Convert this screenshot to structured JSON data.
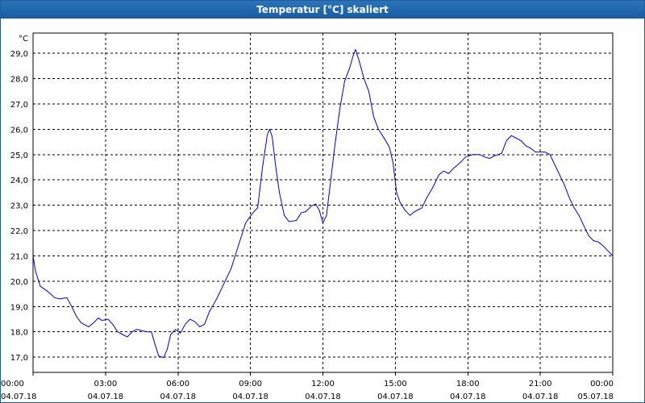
{
  "window": {
    "title": "Temperatur [°C] skaliert"
  },
  "chart_data": {
    "type": "line",
    "title": "Temperatur [°C] skaliert",
    "xlabel": "",
    "ylabel": "°C",
    "grid": true,
    "line_color": "#0000cc",
    "grid_color": "#000000",
    "ylim": [
      16.4,
      29.8
    ],
    "x_range_hours": [
      0,
      24
    ],
    "y_ticks": [
      "29,0",
      "28,0",
      "27,0",
      "26,0",
      "25,0",
      "24,0",
      "23,0",
      "22,0",
      "21,0",
      "20,0",
      "19,0",
      "18,0",
      "17,0"
    ],
    "y_tick_values": [
      29,
      28,
      27,
      26,
      25,
      24,
      23,
      22,
      21,
      20,
      19,
      18,
      17
    ],
    "x_ticks": [
      {
        "time": "00:00",
        "date": "04.07.18",
        "hour": 0
      },
      {
        "time": "03:00",
        "date": "04.07.18",
        "hour": 3
      },
      {
        "time": "06:00",
        "date": "04.07.18",
        "hour": 6
      },
      {
        "time": "09:00",
        "date": "04.07.18",
        "hour": 9
      },
      {
        "time": "12:00",
        "date": "04.07.18",
        "hour": 12
      },
      {
        "time": "15:00",
        "date": "04.07.18",
        "hour": 15
      },
      {
        "time": "18:00",
        "date": "04.07.18",
        "hour": 18
      },
      {
        "time": "21:00",
        "date": "04.07.18",
        "hour": 21
      },
      {
        "time": "00:00",
        "date": "05.07.18",
        "hour": 24
      }
    ],
    "series": [
      {
        "name": "",
        "points": [
          [
            0.0,
            21.0
          ],
          [
            0.1,
            20.4
          ],
          [
            0.3,
            19.8
          ],
          [
            0.6,
            19.6
          ],
          [
            0.9,
            19.35
          ],
          [
            1.1,
            19.3
          ],
          [
            1.4,
            19.35
          ],
          [
            1.6,
            19.0
          ],
          [
            1.8,
            18.6
          ],
          [
            2.0,
            18.35
          ],
          [
            2.3,
            18.2
          ],
          [
            2.5,
            18.35
          ],
          [
            2.7,
            18.55
          ],
          [
            2.85,
            18.45
          ],
          [
            3.1,
            18.5
          ],
          [
            3.3,
            18.3
          ],
          [
            3.5,
            18.0
          ],
          [
            3.7,
            17.9
          ],
          [
            3.9,
            17.8
          ],
          [
            4.1,
            18.0
          ],
          [
            4.3,
            18.1
          ],
          [
            4.5,
            18.05
          ],
          [
            4.7,
            18.0
          ],
          [
            4.9,
            18.0
          ],
          [
            5.05,
            17.5
          ],
          [
            5.2,
            17.05
          ],
          [
            5.4,
            16.98
          ],
          [
            5.55,
            17.3
          ],
          [
            5.7,
            17.9
          ],
          [
            5.9,
            18.1
          ],
          [
            6.1,
            17.95
          ],
          [
            6.3,
            18.3
          ],
          [
            6.5,
            18.5
          ],
          [
            6.7,
            18.4
          ],
          [
            6.9,
            18.2
          ],
          [
            7.1,
            18.3
          ],
          [
            7.3,
            18.8
          ],
          [
            7.6,
            19.3
          ],
          [
            7.9,
            19.9
          ],
          [
            8.2,
            20.5
          ],
          [
            8.5,
            21.4
          ],
          [
            8.8,
            22.3
          ],
          [
            9.1,
            22.7
          ],
          [
            9.3,
            22.9
          ],
          [
            9.5,
            24.5
          ],
          [
            9.7,
            25.8
          ],
          [
            9.8,
            26.0
          ],
          [
            9.9,
            25.7
          ],
          [
            10.05,
            24.5
          ],
          [
            10.2,
            23.5
          ],
          [
            10.4,
            22.6
          ],
          [
            10.6,
            22.35
          ],
          [
            10.9,
            22.4
          ],
          [
            11.1,
            22.7
          ],
          [
            11.3,
            22.75
          ],
          [
            11.5,
            22.95
          ],
          [
            11.7,
            23.05
          ],
          [
            11.85,
            22.8
          ],
          [
            12.0,
            22.3
          ],
          [
            12.15,
            22.6
          ],
          [
            12.3,
            23.8
          ],
          [
            12.5,
            25.4
          ],
          [
            12.7,
            26.8
          ],
          [
            12.9,
            27.9
          ],
          [
            13.1,
            28.4
          ],
          [
            13.25,
            28.9
          ],
          [
            13.35,
            29.15
          ],
          [
            13.5,
            28.7
          ],
          [
            13.7,
            28.0
          ],
          [
            13.9,
            27.5
          ],
          [
            14.1,
            26.5
          ],
          [
            14.3,
            26.0
          ],
          [
            14.5,
            25.7
          ],
          [
            14.75,
            25.3
          ],
          [
            14.9,
            24.7
          ],
          [
            15.05,
            23.5
          ],
          [
            15.2,
            23.1
          ],
          [
            15.4,
            22.8
          ],
          [
            15.6,
            22.6
          ],
          [
            15.8,
            22.75
          ],
          [
            16.1,
            22.9
          ],
          [
            16.3,
            23.3
          ],
          [
            16.55,
            23.7
          ],
          [
            16.8,
            24.2
          ],
          [
            17.0,
            24.35
          ],
          [
            17.2,
            24.25
          ],
          [
            17.4,
            24.45
          ],
          [
            17.7,
            24.7
          ],
          [
            17.9,
            24.9
          ],
          [
            18.2,
            25.0
          ],
          [
            18.5,
            25.0
          ],
          [
            18.7,
            24.9
          ],
          [
            18.9,
            24.85
          ],
          [
            19.1,
            24.95
          ],
          [
            19.4,
            25.05
          ],
          [
            19.6,
            25.55
          ],
          [
            19.8,
            25.75
          ],
          [
            20.0,
            25.65
          ],
          [
            20.2,
            25.55
          ],
          [
            20.4,
            25.35
          ],
          [
            20.6,
            25.25
          ],
          [
            20.8,
            25.1
          ],
          [
            21.0,
            25.1
          ],
          [
            21.2,
            25.1
          ],
          [
            21.4,
            25.0
          ],
          [
            21.6,
            24.6
          ],
          [
            21.8,
            24.2
          ],
          [
            22.0,
            23.8
          ],
          [
            22.2,
            23.3
          ],
          [
            22.4,
            22.9
          ],
          [
            22.6,
            22.6
          ],
          [
            22.8,
            22.2
          ],
          [
            23.0,
            21.8
          ],
          [
            23.2,
            21.6
          ],
          [
            23.4,
            21.55
          ],
          [
            23.6,
            21.4
          ],
          [
            23.8,
            21.2
          ],
          [
            24.0,
            21.0
          ]
        ]
      }
    ]
  }
}
